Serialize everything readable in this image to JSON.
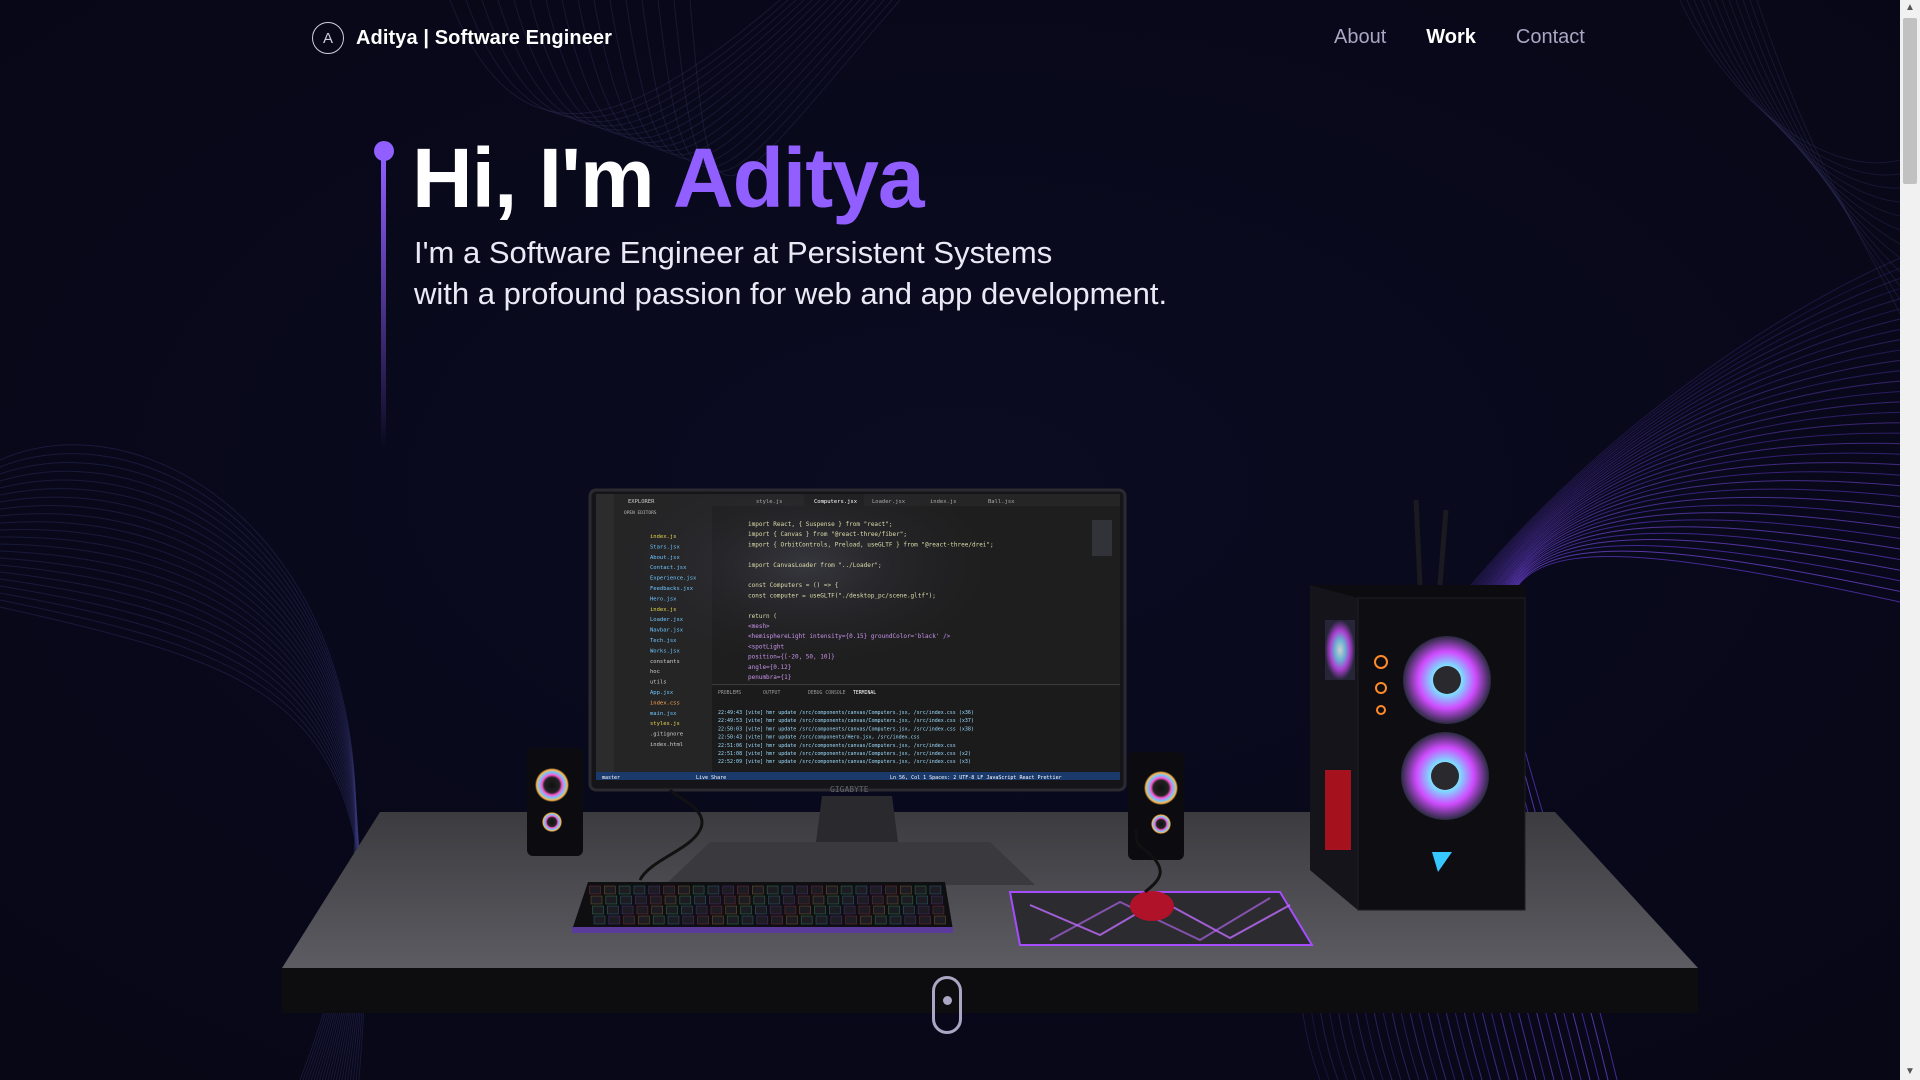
{
  "brand": {
    "logo_glyph": "A",
    "name": "Aditya | Software Engineer"
  },
  "nav": {
    "items": [
      {
        "label": "About",
        "active": false
      },
      {
        "label": "Work",
        "active": true
      },
      {
        "label": "Contact",
        "active": false
      }
    ]
  },
  "hero": {
    "greeting": "Hi, I'm ",
    "name": "Aditya",
    "subtitle_line1": "I'm a Software Engineer at Persistent Systems",
    "subtitle_line2": "with a profound passion for web and app development."
  },
  "monitor": {
    "brand": "GIGABYTE",
    "explorer_title": "EXPLORER",
    "open_editors": "OPEN EDITORS",
    "tabs": [
      "style.js",
      "Computers.jsx",
      "Loader.jsx",
      "index.js",
      "Ball.jsx"
    ],
    "files": [
      "index.js",
      "Stars.jsx",
      "About.jsx",
      "Contact.jsx",
      "Experience.jsx",
      "Feedbacks.jsx",
      "Hero.jsx",
      "index.js",
      "Loader.jsx",
      "Navbar.jsx",
      "Tech.jsx",
      "Works.jsx",
      "constants",
      "hoc",
      "utils",
      "App.jsx",
      "index.css",
      "main.jsx",
      "styles.js",
      ".gitignore",
      "index.html"
    ],
    "code_lines": [
      "import React, { Suspense } from \"react\";",
      "import { Canvas } from \"@react-three/fiber\";",
      "import { OrbitControls, Preload, useGLTF } from \"@react-three/drei\";",
      "",
      "import CanvasLoader from \"../Loader\";",
      "",
      "const Computers = () => {",
      "  const computer = useGLTF(\"./desktop_pc/scene.gltf\");",
      "",
      "  return (",
      "    <mesh>",
      "      <hemisphereLight intensity={0.15} groundColor='black' />",
      "      <spotLight",
      "        position={[-20, 50, 10]}",
      "        angle={0.12}",
      "        penumbra={1}"
    ],
    "terminal_tabs": [
      "PROBLEMS",
      "OUTPUT",
      "DEBUG CONSOLE",
      "TERMINAL"
    ],
    "terminal_lines": [
      "22:49:43 [vite] hmr update /src/components/canvas/Computers.jsx, /src/index.css (x36)",
      "22:49:53 [vite] hmr update /src/components/canvas/Computers.jsx, /src/index.css (x37)",
      "22:50:03 [vite] hmr update /src/components/canvas/Computers.jsx, /src/index.css (x38)",
      "22:50:43 [vite] hmr update /src/components/Hero.jsx, /src/index.css",
      "22:51:06 [vite] hmr update /src/components/canvas/Computers.jsx, /src/index.css",
      "22:51:08 [vite] hmr update /src/components/canvas/Computers.jsx, /src/index.css (x2)",
      "22:52:09 [vite] hmr update /src/components/canvas/Computers.jsx, /src/index.css (x3)"
    ],
    "status_left": "master",
    "status_live_share": "Live Share",
    "status_right": "Ln 56, Col 1   Spaces: 2   UTF-8   LF   JavaScript React   Prettier"
  },
  "scroll_indicator": {
    "icon": "mouse-scroll-icon"
  },
  "colors": {
    "background": "#0a0a1e",
    "accent": "#915eff",
    "nav_inactive": "#aaa6c3",
    "text": "#ffffff"
  }
}
